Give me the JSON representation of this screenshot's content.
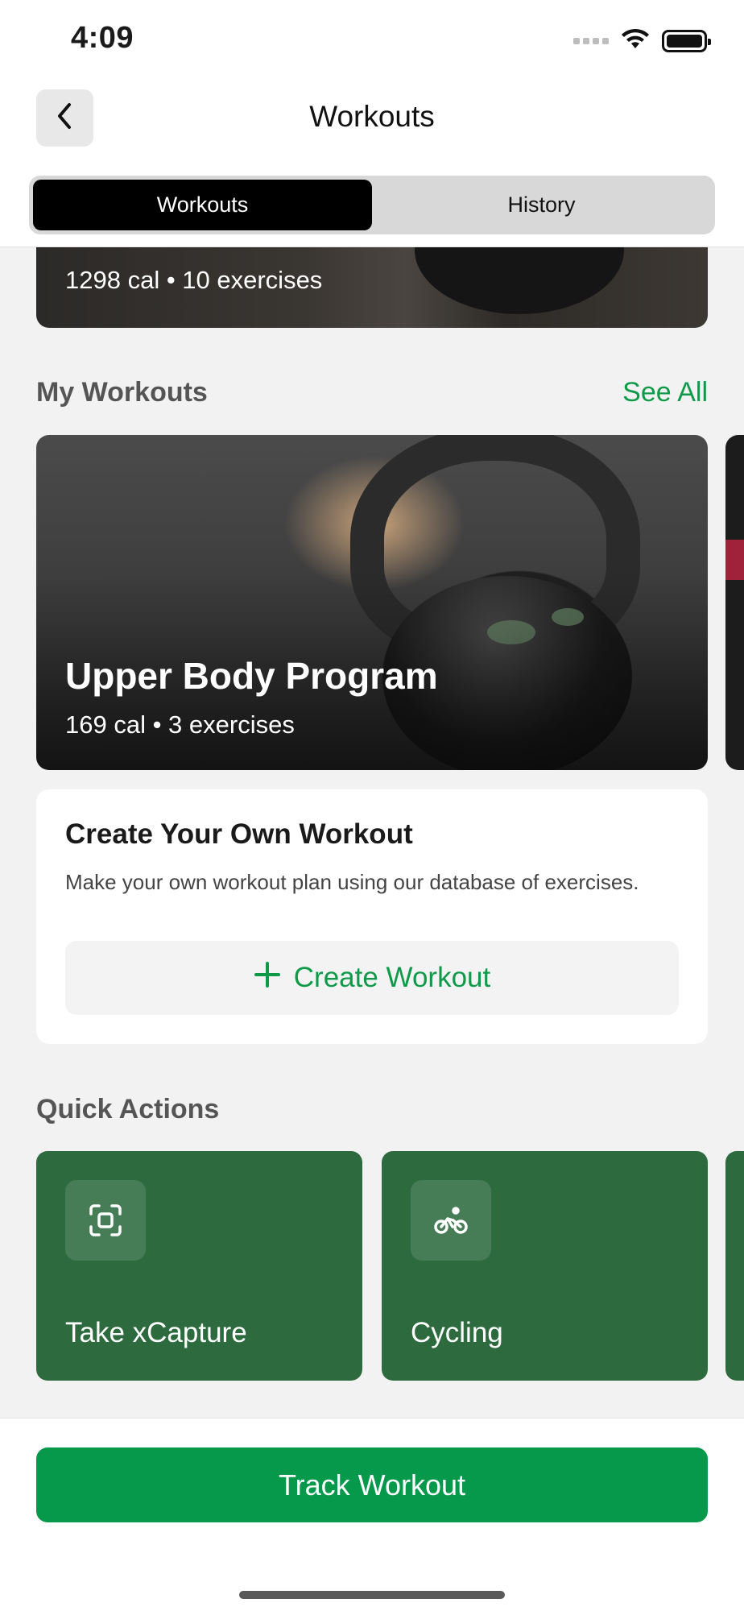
{
  "status_bar": {
    "time": "4:09"
  },
  "nav": {
    "title": "Workouts"
  },
  "segments": [
    {
      "label": "Workouts",
      "active": true
    },
    {
      "label": "History",
      "active": false
    }
  ],
  "featured_partial": {
    "subtitle": "1298 cal • 10 exercises"
  },
  "my_workouts": {
    "title": "My Workouts",
    "see_all": "See All",
    "cards": [
      {
        "name": "Upper Body Program",
        "subtitle": "169 cal • 3 exercises"
      }
    ]
  },
  "create": {
    "title": "Create Your Own Workout",
    "description": "Make your own workout plan using our database of exercises.",
    "button": "Create Workout"
  },
  "quick_actions": {
    "title": "Quick Actions",
    "items": [
      {
        "label": "Take xCapture",
        "icon": "scan-icon"
      },
      {
        "label": "Cycling",
        "icon": "bicycle-icon"
      }
    ]
  },
  "footer": {
    "button": "Track Workout"
  },
  "colors": {
    "accent": "#0f9a4a",
    "action_card": "#2d6b3f",
    "primary_button": "#07994b"
  }
}
